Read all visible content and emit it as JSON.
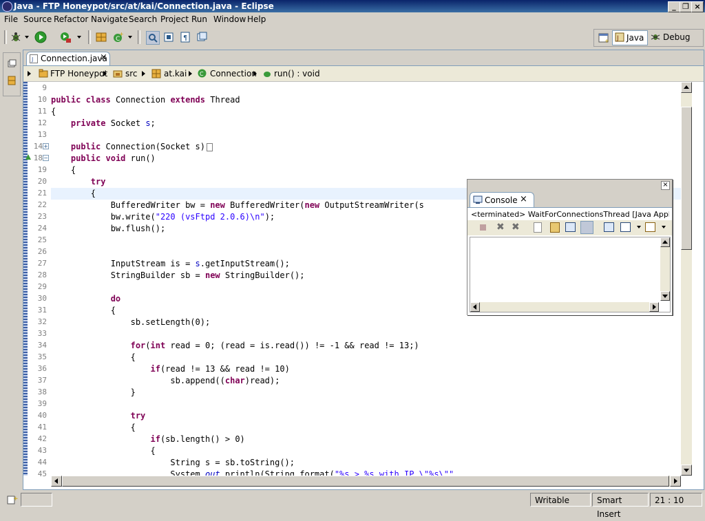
{
  "window": {
    "title": "Java - FTP Honeypot/src/at/kai/Connection.java - Eclipse",
    "controls": [
      "_",
      "❐",
      "×"
    ]
  },
  "menu": [
    "File",
    "Source",
    "Refactor",
    "Navigate",
    "Search",
    "Project",
    "Run",
    "Window",
    "Help"
  ],
  "perspectives": {
    "java": "Java",
    "debug": "Debug"
  },
  "editor": {
    "tab_label": "Connection.java",
    "breadcrumb": [
      "FTP Honeypot",
      "src",
      "at.kai",
      "Connection",
      "run() : void"
    ]
  },
  "line_numbers": [
    "9",
    "10",
    "11",
    "12",
    "13",
    "14",
    "18",
    "19",
    "20",
    "21",
    "22",
    "23",
    "24",
    "25",
    "26",
    "27",
    "28",
    "29",
    "30",
    "31",
    "32",
    "33",
    "34",
    "35",
    "36",
    "37",
    "38",
    "39",
    "40",
    "41",
    "42",
    "43",
    "44",
    "45"
  ],
  "code": {
    "l10_kw1": "public",
    "l10_kw2": "class",
    "l10_name": "Connection",
    "l10_kw3": "extends",
    "l10_base": "Thread",
    "l11": "{",
    "l12_kw": "private",
    "l12_type": "Socket",
    "l12_field": "s",
    "l12_end": ";",
    "l14_kw": "public",
    "l14_sig": "Connection(Socket s)",
    "l18_kw1": "public",
    "l18_kw2": "void",
    "l18_sig": "run()",
    "l19": "{",
    "l20_kw": "try",
    "l21": "{",
    "l22_a": "BufferedWriter bw = ",
    "l22_kw1": "new",
    "l22_b": " BufferedWriter(",
    "l22_kw2": "new",
    "l22_c": " OutputStreamWriter(s",
    "l23_a": "bw.write(",
    "l23_str": "\"220 (vsFtpd 2.0.6)\\n\"",
    "l23_b": ");",
    "l24": "bw.flush();",
    "l27_a": "InputStream is = ",
    "l27_field": "s",
    "l27_b": ".getInputStream();",
    "l28_a": "StringBuilder sb = ",
    "l28_kw": "new",
    "l28_b": " StringBuilder();",
    "l30_kw": "do",
    "l31": "{",
    "l32": "sb.setLength(0);",
    "l34_kw1": "for",
    "l34_a": "(",
    "l34_kw2": "int",
    "l34_b": " read = 0; (read = is.read()) != -1 && read != 13;)",
    "l35": "{",
    "l36_kw": "if",
    "l36_a": "(read != 13 && read != 10)",
    "l37_a": "sb.append((",
    "l37_kw": "char",
    "l37_b": ")read);",
    "l38": "}",
    "l40_kw": "try",
    "l41": "{",
    "l42_kw": "if",
    "l42_a": "(sb.length() > 0)",
    "l43": "{",
    "l44_a": "String s = sb.toString();",
    "l45_a": "System.",
    "l45_it": "out",
    "l45_b": ".println(String.format(",
    "l45_str": "\"%s > %s with IP \\\"%s\\\"\""
  },
  "console": {
    "tab_label": "Console",
    "description": "<terminated> WaitForConnectionsThread [Java Application"
  },
  "status": {
    "writable": "Writable",
    "insert_mode": "Smart Insert",
    "position": "21 : 10"
  },
  "colors": {
    "keyword": "#7f0055",
    "string": "#2a00ff",
    "field": "#0000c0",
    "highlight": "#e00000"
  }
}
